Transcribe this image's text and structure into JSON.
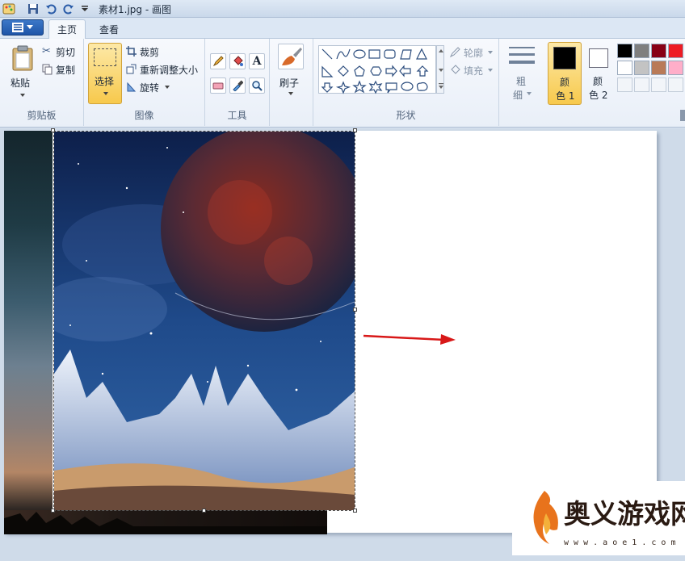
{
  "window": {
    "title": "素材1.jpg - 画图"
  },
  "tabs": {
    "home": "主页",
    "view": "查看"
  },
  "clipboard": {
    "paste": "粘贴",
    "cut": "剪切",
    "copy": "复制",
    "group": "剪贴板"
  },
  "image": {
    "select": "选择",
    "crop": "裁剪",
    "resize": "重新调整大小",
    "rotate": "旋转",
    "group": "图像"
  },
  "tools": {
    "group": "工具"
  },
  "brushes": {
    "label": "刷子"
  },
  "shapes": {
    "outline": "轮廓",
    "fill": "填充",
    "group": "形状"
  },
  "size": {
    "line1": "粗",
    "line2": "细"
  },
  "colors": {
    "color1_line1": "颜",
    "color1_line2": "色 1",
    "color2_line1": "颜",
    "color2_line2": "色 2",
    "color1_value": "#000000",
    "color2_value": "#ffffff",
    "palette": [
      "#000000",
      "#7f7f7f",
      "#880015",
      "#ed1c24",
      "#ffffff",
      "#c3c3c3",
      "#b97a57",
      "#ffaec9"
    ]
  },
  "watermark": {
    "brand": "奥义游戏网",
    "url": "w w w . a o e 1 . c o m"
  }
}
